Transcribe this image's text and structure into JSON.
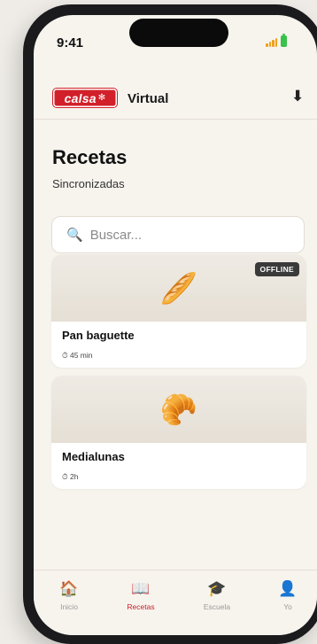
{
  "status": {
    "time": "9:41"
  },
  "header": {
    "logo_text": "calsa",
    "brand": "Virtual"
  },
  "page": {
    "title": "Recetas",
    "subtitle": "Sincronizadas"
  },
  "search": {
    "placeholder": "Buscar..."
  },
  "recipes": [
    {
      "name": "Pan baguette",
      "time": "⏱ 45 min",
      "badge": "OFFLINE",
      "image": "🥖"
    },
    {
      "name": "Medialunas",
      "time": "⏱ 2h",
      "badge": "",
      "image": "🥐"
    }
  ],
  "tabs": [
    {
      "label": "Inicio",
      "icon": "🏠",
      "active": false
    },
    {
      "label": "Recetas",
      "icon": "📖",
      "active": true
    },
    {
      "label": "Escuela",
      "icon": "🎓",
      "active": false
    },
    {
      "label": "Yo",
      "icon": "👤",
      "active": false
    }
  ],
  "colors": {
    "accent": "#c8202b",
    "logo_bg": "#d2202a"
  }
}
